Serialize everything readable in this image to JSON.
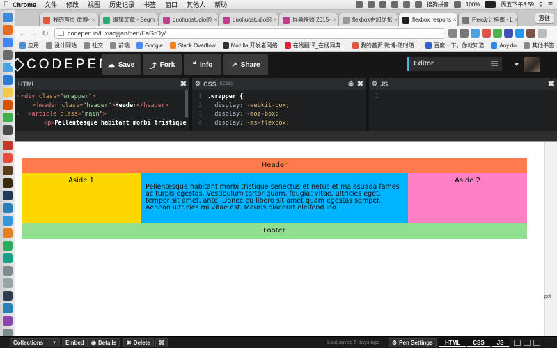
{
  "menubar": {
    "app": "Chrome",
    "items": [
      "文件",
      "修改",
      "视图",
      "历史记录",
      "书签",
      "窗口",
      "其他人",
      "帮助"
    ],
    "input_method": "搜狗拼音",
    "battery": "100%",
    "clock": "周五下午8:59"
  },
  "tabs": [
    {
      "label": "我的首页 微博-",
      "color": "#e05a3a"
    },
    {
      "label": "编辑文章 - Segm",
      "color": "#2aa876"
    },
    {
      "label": "duohuostudio的",
      "color": "#c03e8f"
    },
    {
      "label": "duohuostudio的",
      "color": "#c03e8f"
    },
    {
      "label": "屏幕快照 2015-",
      "color": "#c03e8f"
    },
    {
      "label": "flexbox更加优化",
      "color": "#999999"
    },
    {
      "label": "flexbox respons",
      "color": "#222222"
    },
    {
      "label": "Flex设计指南 - L",
      "color": "#777777"
    }
  ],
  "tab_user": "憲健",
  "address_bar": {
    "url": "codepen.io/luxiaojijan/pen/EaGrOy/"
  },
  "bookmarks": [
    {
      "label": "应用",
      "color": "#4a90d9"
    },
    {
      "label": "设计网站",
      "color": "#888888"
    },
    {
      "label": "社交",
      "color": "#888888"
    },
    {
      "label": "前端",
      "color": "#888888"
    },
    {
      "label": "Google",
      "color": "#4a8af4"
    },
    {
      "label": "Stack Overflow",
      "color": "#f48024"
    },
    {
      "label": "Mozilla 开发者网络",
      "color": "#333333"
    },
    {
      "label": "在线翻译_在线词典...",
      "color": "#d23"
    },
    {
      "label": "我的首页 微博-随时随...",
      "color": "#e05a3a"
    },
    {
      "label": "百度一下，你就知道",
      "color": "#3060d0"
    },
    {
      "label": "Any.do",
      "color": "#2a8ae6"
    },
    {
      "label": "其他书签",
      "color": "#888888"
    }
  ],
  "codepen": {
    "logo": "CODEPEN",
    "save_label": "Save",
    "fork_label": "Fork",
    "info_label": "Info",
    "share_label": "Share",
    "view_mode": "Editor"
  },
  "editors": {
    "html_title": "HTML",
    "css_title": "CSS",
    "css_sub": "(SCSS)",
    "js_title": "JS",
    "js_line1": "1"
  },
  "preview": {
    "header": "Header",
    "aside1": "Aside 1",
    "aside2": "Aside 2",
    "main": "Pellentesque habitant morbi tristique senectus et netus et malesuada fames ac turpis egestas. Vestibulum tortor quam, feugiat vitae, ultricies eget, tempor sit amet, ante. Donec eu libero sit amet quam egestas semper. Aenean ultricies mi vitae est. Mauris placerat eleifend leo.",
    "footer": "Footer",
    "side_text": "pdt"
  },
  "bottom_bar": {
    "collections": "Collections",
    "embed": "Embed",
    "details": "Details",
    "delete": "Delete",
    "saved": "Last saved 5 days ago",
    "pen_settings": "Pen Settings",
    "view_html": "HTML",
    "view_css": "CSS",
    "view_js": "JS"
  }
}
